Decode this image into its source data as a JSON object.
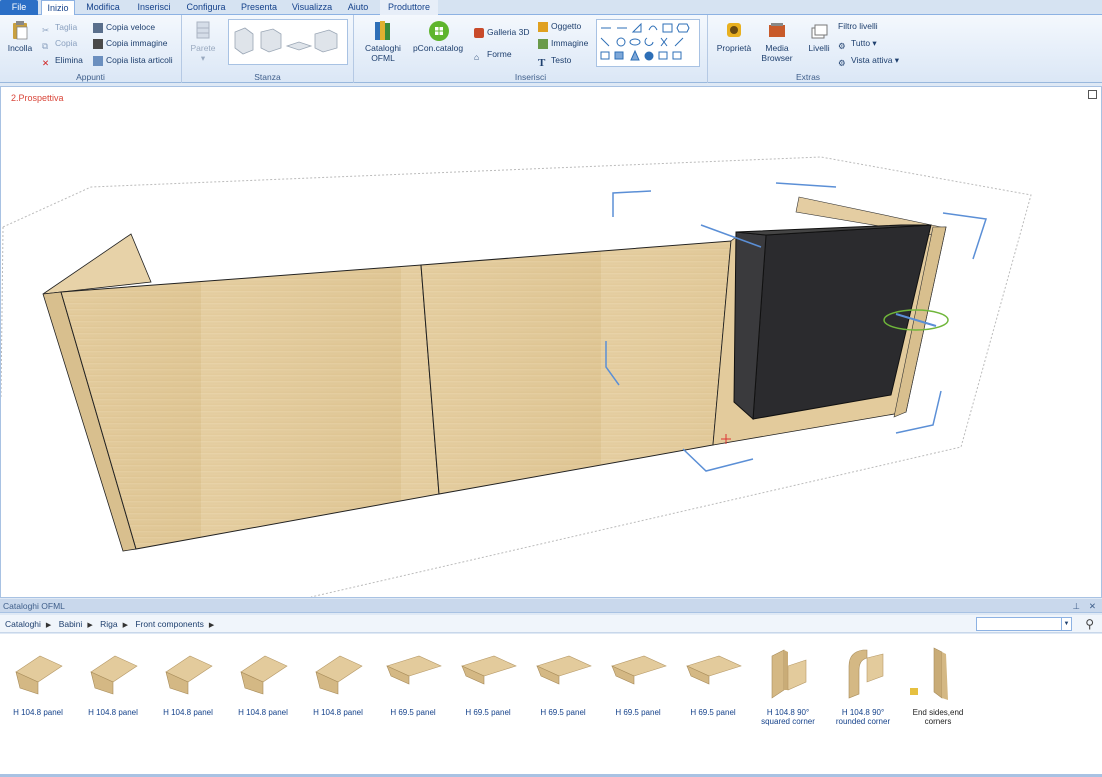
{
  "tabs": [
    "File",
    "Inizio",
    "Modifica",
    "Inserisci",
    "Configura",
    "Presenta",
    "Visualizza",
    "Aiuto",
    "Produttore"
  ],
  "ribbon": {
    "appunti": {
      "paste": "Incolla",
      "cut": "Taglia",
      "copy": "Copia",
      "delete": "Elimina",
      "quick_copy": "Copia veloce",
      "copy_image": "Copia immagine",
      "copy_list": "Copia lista articoli",
      "label": "Appunti"
    },
    "stanza": {
      "wall": "Parete",
      "label": "Stanza"
    },
    "inserisci": {
      "ofml": "Cataloghi\nOFML",
      "pcon": "pCon.catalog",
      "gallery3d": "Galleria 3D",
      "shapes": "Forme",
      "object": "Oggetto",
      "image": "Immagine",
      "text": "Testo",
      "label": "Inserisci"
    },
    "extras": {
      "props": "Proprietà",
      "media": "Media\nBrowser",
      "levels": "Livelli",
      "filter": "Filtro livelli",
      "all": "Tutto",
      "active_view": "Vista attiva",
      "label": "Extras"
    }
  },
  "viewport": {
    "label": "2.Prospettiva"
  },
  "catalog": {
    "title": "Cataloghi OFML",
    "crumbs": [
      "Cataloghi",
      "Babini",
      "Riga",
      "Front components"
    ],
    "items": [
      "H 104.8 panel",
      "H 104.8 panel",
      "H 104.8 panel",
      "H 104.8 panel",
      "H 104.8 panel",
      "H 69.5 panel",
      "H 69.5 panel",
      "H 69.5 panel",
      "H 69.5 panel",
      "H 69.5 panel",
      "H 104.8 90° squared corner",
      "H 104.8 90° rounded corner",
      "End sides,end corners"
    ]
  },
  "colors": {
    "accent": "#2b6fc6",
    "wood": "#e8d3a8",
    "dark_panel": "#2b2b2e",
    "view_label": "#d9463a"
  }
}
